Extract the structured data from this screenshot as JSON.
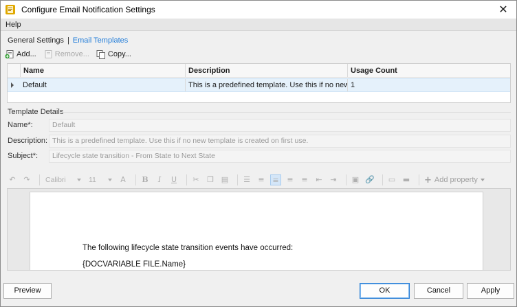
{
  "window": {
    "title": "Configure Email Notification Settings"
  },
  "menu": {
    "help": "Help"
  },
  "tabs": {
    "general": "General Settings",
    "separator": "|",
    "email": "Email Templates"
  },
  "toolbar": {
    "add": "Add...",
    "remove": "Remove...",
    "copy": "Copy..."
  },
  "grid": {
    "headers": {
      "name": "Name",
      "description": "Description",
      "usage": "Usage Count"
    },
    "rows": [
      {
        "name": "Default",
        "description": "This is a predefined template. Use this if no new t...",
        "usage": "1"
      }
    ]
  },
  "details": {
    "section": "Template Details",
    "name_label": "Name*:",
    "name_value": "Default",
    "description_label": "Description:",
    "description_value": "This is a predefined template. Use this if no new template is created on first use.",
    "subject_label": "Subject*:",
    "subject_value": "Lifecycle state transition - From State to Next State"
  },
  "editor_toolbar": {
    "font": "Calibri",
    "size": "11",
    "add_property": "Add property"
  },
  "document": {
    "line1": "The following lifecycle state transition events have occurred:",
    "line2": "{DOCVARIABLE FILE.Name}"
  },
  "buttons": {
    "preview": "Preview",
    "ok": "OK",
    "cancel": "Cancel",
    "apply": "Apply"
  },
  "colors": {
    "accent": "#1f7bd8",
    "selection": "#e5f1fb"
  }
}
